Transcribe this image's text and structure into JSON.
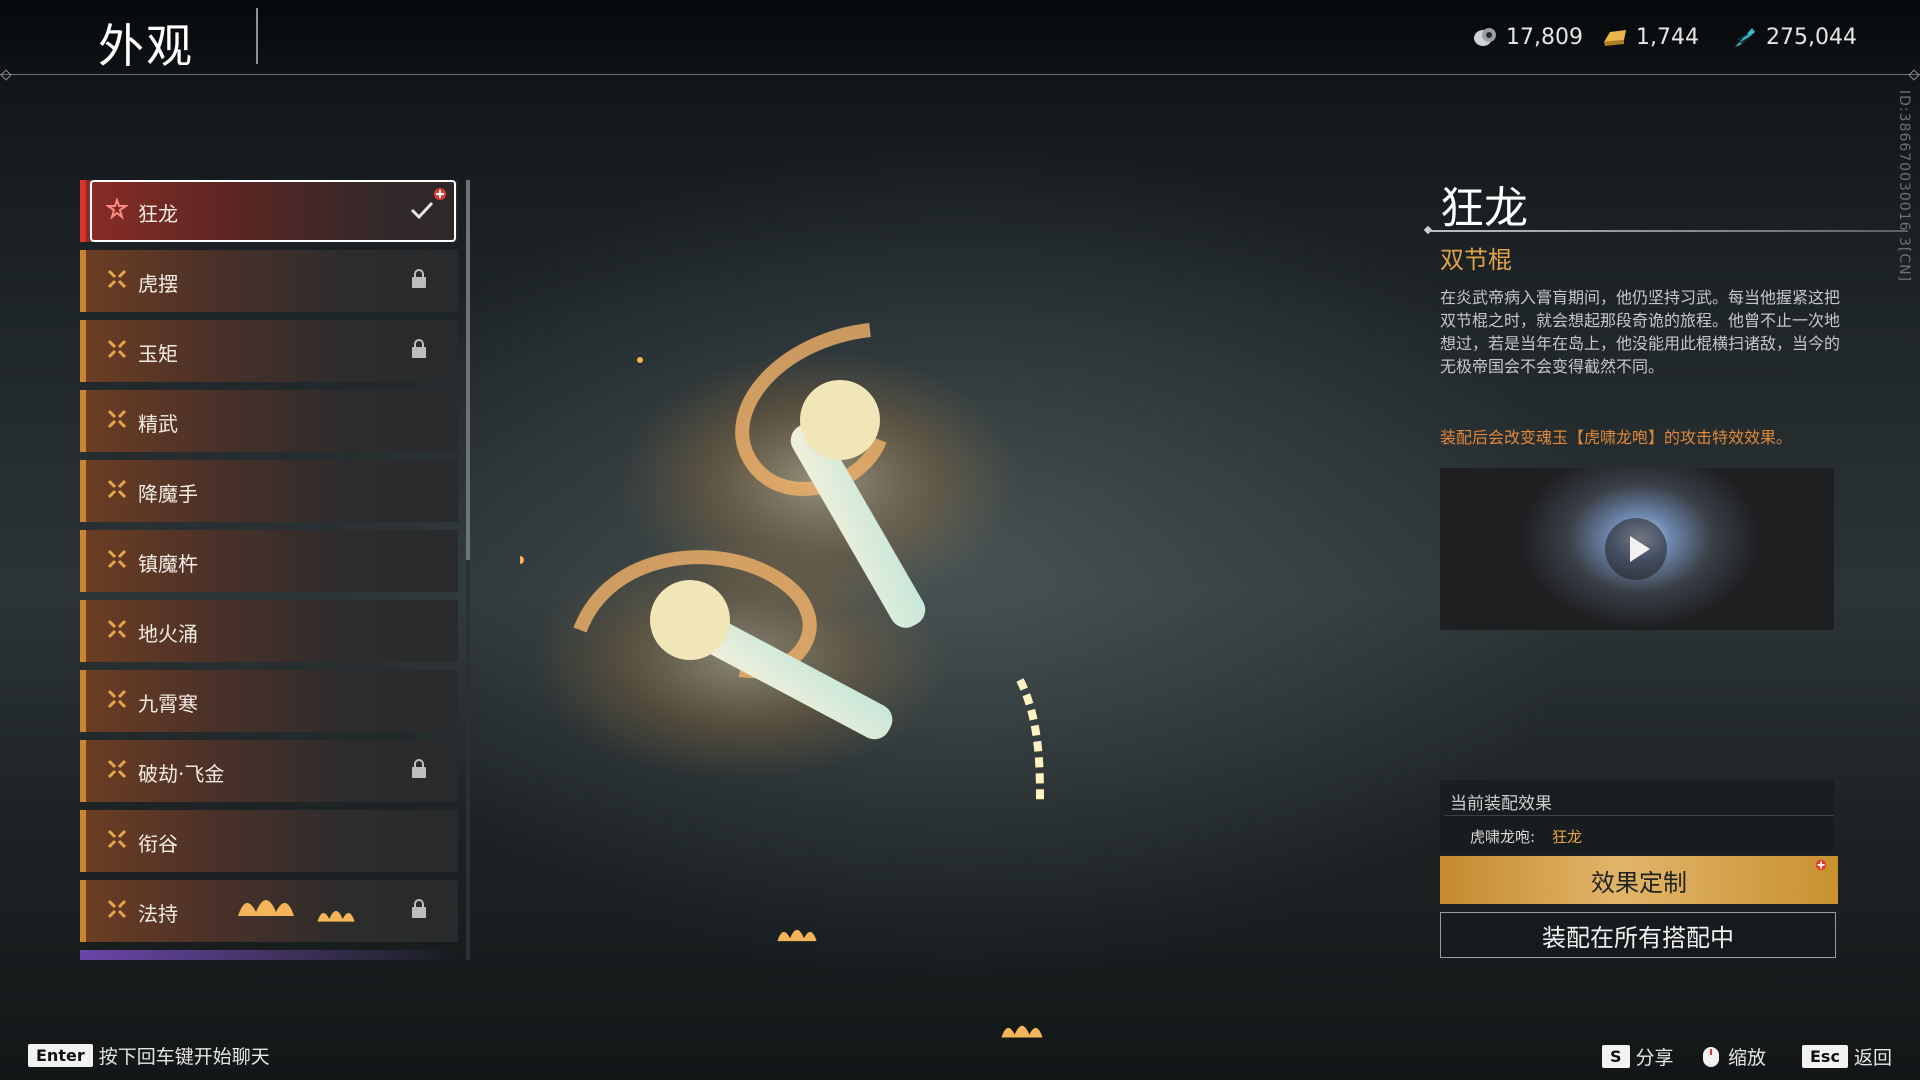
{
  "header": {
    "title": "外观",
    "currencies": [
      {
        "icon": "jade-coin-icon",
        "value": "17,809"
      },
      {
        "icon": "gold-ingot-icon",
        "value": "1,744"
      },
      {
        "icon": "feather-token-icon",
        "value": "275,044"
      }
    ],
    "side_id": "ID:386670030016 3[CN]"
  },
  "skin_list": {
    "items": [
      {
        "label": "狂龙",
        "selected": true,
        "locked": false,
        "equipped": true
      },
      {
        "label": "虎摆",
        "selected": false,
        "locked": true
      },
      {
        "label": "玉矩",
        "selected": false,
        "locked": true
      },
      {
        "label": "精武",
        "selected": false,
        "locked": false
      },
      {
        "label": "降魔手",
        "selected": false,
        "locked": false
      },
      {
        "label": "镇魔杵",
        "selected": false,
        "locked": false
      },
      {
        "label": "地火涌",
        "selected": false,
        "locked": false
      },
      {
        "label": "九霄寒",
        "selected": false,
        "locked": false
      },
      {
        "label": "破劫·飞金",
        "selected": false,
        "locked": true
      },
      {
        "label": "衔谷",
        "selected": false,
        "locked": false
      },
      {
        "label": "法持",
        "selected": false,
        "locked": true
      }
    ]
  },
  "detail": {
    "name": "狂龙",
    "type": "双节棍",
    "description": "在炎武帝病入膏肓期间，他仍坚持习武。每当他握紧这把双节棍之时，就会想起那段奇诡的旅程。他曾不止一次地想过，若是当年在岛上，他没能用此棍横扫诸敌，当今的无极帝国会不会变得截然不同。",
    "effect_note": "装配后会改变魂玉【虎啸龙咆】的攻击特效效果。",
    "current_effect_title": "当前装配效果",
    "current_effect_key": "虎啸龙咆:",
    "current_effect_value": "狂龙",
    "customize_button": "效果定制",
    "equip_all_button": "装配在所有搭配中"
  },
  "footer": {
    "chat_key": "Enter",
    "chat_label": "按下回车键开始聊天",
    "share_key": "S",
    "share_label": "分享",
    "zoom_label": "缩放",
    "back_key": "Esc",
    "back_label": "返回"
  },
  "colors": {
    "accent_gold": "#e0a24a",
    "accent_orange": "#e0883a",
    "selected_red": "#d6352b"
  }
}
